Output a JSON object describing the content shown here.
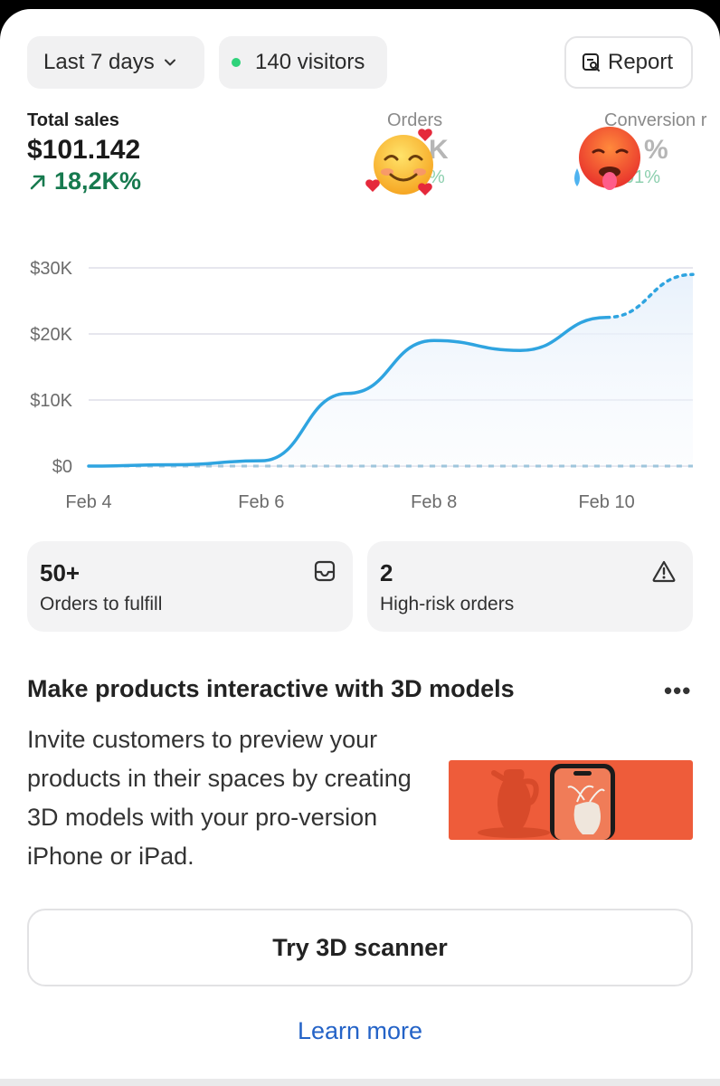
{
  "filters": {
    "range_label": "Last 7 days",
    "visitors_label": "140 visitors",
    "report_label": "Report"
  },
  "metrics": [
    {
      "label": "Total sales",
      "value": "$101.142",
      "change": "18,2K%"
    },
    {
      "label": "Orders",
      "value": "K",
      "change": "%"
    },
    {
      "label": "Conversion r",
      "value": "%",
      "change": "01%"
    }
  ],
  "stickers": [
    "smiling-face-with-hearts",
    "hot-face"
  ],
  "chart_data": {
    "type": "line",
    "x": [
      "Feb 4",
      "Feb 5",
      "Feb 6",
      "Feb 7",
      "Feb 8",
      "Feb 9",
      "Feb 10",
      "Feb 11"
    ],
    "series": [
      {
        "values": [
          0,
          200,
          800,
          11000,
          19000,
          17500,
          22500,
          29000
        ]
      },
      {
        "values": [
          0,
          0,
          0,
          0,
          0,
          0,
          0,
          0
        ]
      }
    ],
    "y_ticks": [
      "$0",
      "$10K",
      "$20K",
      "$30K"
    ],
    "x_ticks": [
      "Feb 4",
      "Feb 6",
      "Feb 8",
      "Feb 10"
    ],
    "ylim": [
      0,
      30000
    ],
    "grid": true,
    "colors": {
      "line": "#2fa4e0",
      "grid": "#dedde8"
    }
  },
  "tasks": [
    {
      "count": "50+",
      "label": "Orders to fulfill",
      "icon": "inbox-icon"
    },
    {
      "count": "2",
      "label": "High-risk orders",
      "icon": "warning-icon"
    }
  ],
  "promo": {
    "title": "Make products interactive with 3D models",
    "more": "•••",
    "body": "Invite customers to preview your products in their spaces by creating 3D models with your pro-version iPhone or iPad.",
    "cta": "Try 3D scanner",
    "link": "Learn more"
  }
}
